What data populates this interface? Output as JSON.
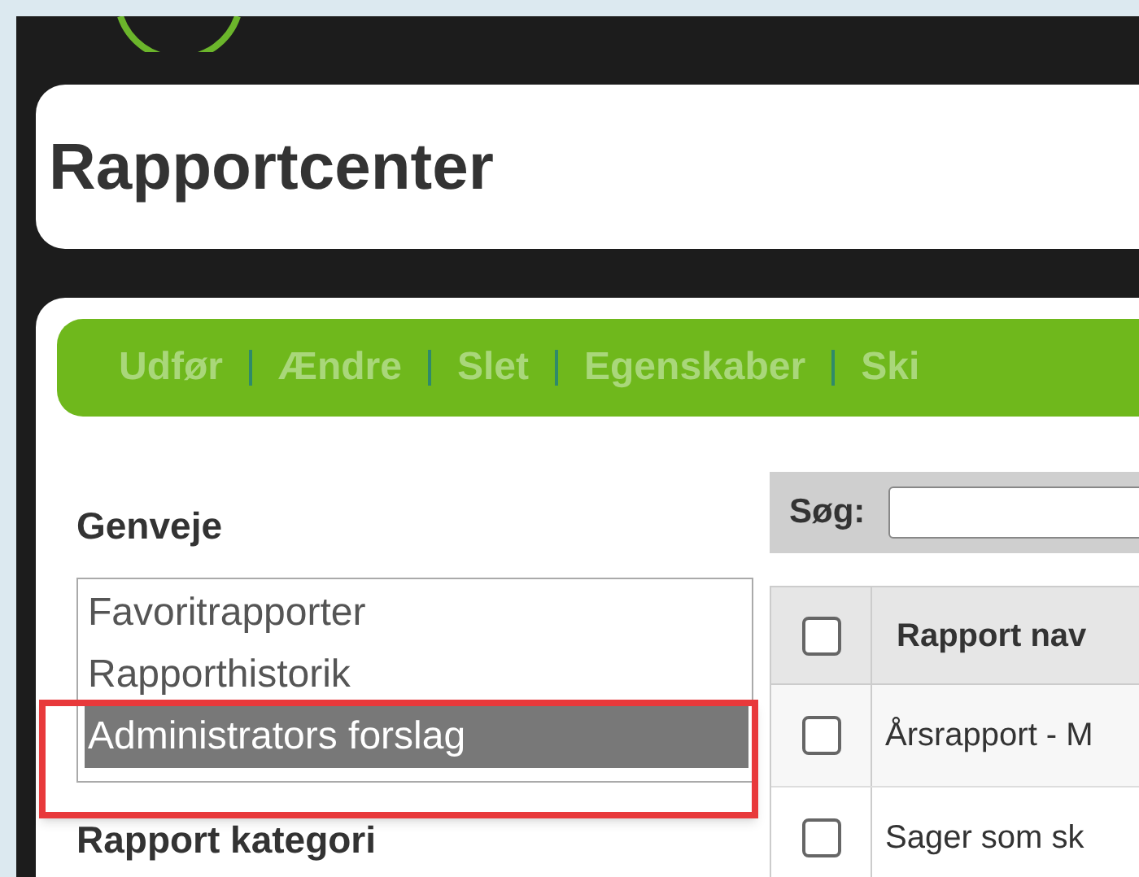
{
  "header": {
    "title": "Rapportcenter"
  },
  "toolbar": {
    "items": [
      {
        "label": "Udfør"
      },
      {
        "label": "Ændre"
      },
      {
        "label": "Slet"
      },
      {
        "label": "Egenskaber"
      },
      {
        "label": "Ski"
      }
    ]
  },
  "shortcuts": {
    "heading": "Genveje",
    "items": [
      {
        "label": "Favoritrapporter",
        "selected": false
      },
      {
        "label": "Rapporthistorik",
        "selected": false
      },
      {
        "label": "Administrators forslag",
        "selected": true
      }
    ]
  },
  "category": {
    "heading": "Rapport kategori"
  },
  "search": {
    "label": "Søg:"
  },
  "table": {
    "select_all": {
      "checked": false
    },
    "columns": [
      "Rapport nav"
    ],
    "rows": [
      {
        "checked": false,
        "cells": [
          "Årsrapport - M"
        ]
      },
      {
        "checked": false,
        "cells": [
          "Sager som sk"
        ]
      }
    ]
  }
}
